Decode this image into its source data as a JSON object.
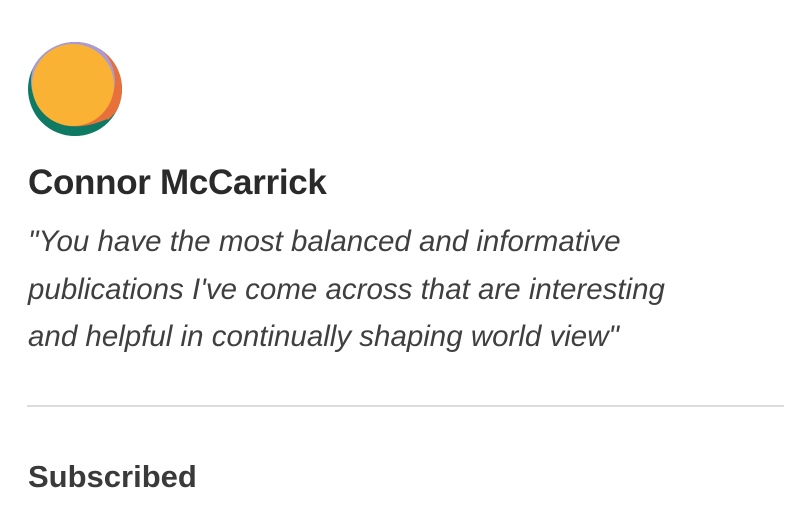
{
  "profile": {
    "avatar_icon": "sun-logo-icon",
    "name": "Connor McCarrick",
    "quote_lines": [
      "\"You have the most balanced and informative",
      "publications I've come across that are interesting",
      "and helpful in continually shaping world view\""
    ],
    "status": "Subscribed"
  },
  "colors": {
    "avatar_main": "#F9B233",
    "avatar_orange": "#E8703A",
    "avatar_green": "#0F7A64",
    "avatar_lavender": "#A99AD8",
    "divider": "#DCDCDC"
  }
}
